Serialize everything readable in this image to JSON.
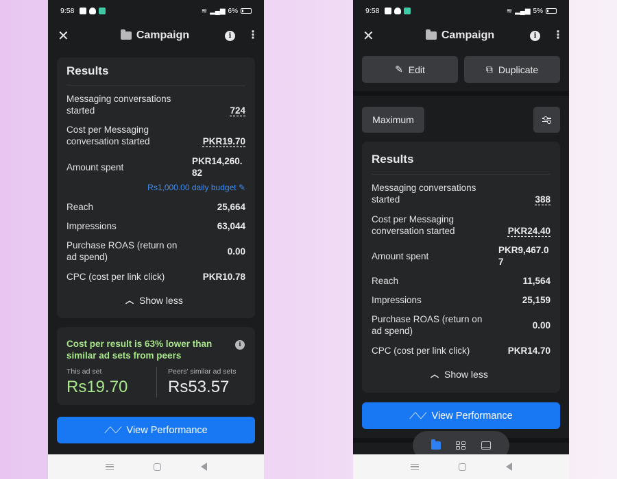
{
  "left_screen": {
    "status_bar": {
      "time": "9:58",
      "battery": "6%"
    },
    "header": {
      "title": "Campaign"
    },
    "results": {
      "title": "Results",
      "metrics": [
        {
          "label": "Messaging conversations started",
          "value": "724"
        },
        {
          "label": "Cost per Messaging conversation started",
          "value": "PKR19.70"
        },
        {
          "label": "Amount spent",
          "value": "PKR14,260.82"
        },
        {
          "label": "Reach",
          "value": "25,664"
        },
        {
          "label": "Impressions",
          "value": "63,044"
        },
        {
          "label": "Purchase ROAS (return on ad spend)",
          "value": "0.00"
        },
        {
          "label": "CPC (cost per link click)",
          "value": "PKR10.78"
        }
      ],
      "daily_budget": "Rs1,000.00 daily budget",
      "show_less": "Show less"
    },
    "peer_comparison": {
      "headline": "Cost per result is 63% lower than similar ad sets from peers",
      "this_label": "This ad set",
      "this_value": "Rs19.70",
      "peers_label": "Peers' similar ad sets",
      "peers_value": "Rs53.57"
    },
    "view_performance": "View Performance"
  },
  "right_screen": {
    "status_bar": {
      "time": "9:58",
      "battery": "5%"
    },
    "header": {
      "title": "Campaign"
    },
    "edit_label": "Edit",
    "duplicate_label": "Duplicate",
    "filter_label": "Maximum",
    "results": {
      "title": "Results",
      "metrics": [
        {
          "label": "Messaging conversations started",
          "value": "388"
        },
        {
          "label": "Cost per Messaging conversation started",
          "value": "PKR24.40"
        },
        {
          "label": "Amount spent",
          "value": "PKR9,467.07"
        },
        {
          "label": "Reach",
          "value": "11,564"
        },
        {
          "label": "Impressions",
          "value": "25,159"
        },
        {
          "label": "Purchase ROAS (return on ad spend)",
          "value": "0.00"
        },
        {
          "label": "CPC (cost per link click)",
          "value": "PKR14.70"
        }
      ],
      "show_less": "Show less"
    },
    "view_performance": "View Performance"
  },
  "icons": {
    "close": "close-icon",
    "folder": "folder-icon",
    "info": "info-icon",
    "more": "more-vertical-icon",
    "edit": "pencil-icon",
    "duplicate": "duplicate-icon",
    "filter": "sliders-icon",
    "trend": "trend-line-icon",
    "chevron": "chevron-up-icon"
  },
  "colors": {
    "background_dark": "#1b1c1e",
    "card": "#252628",
    "accent_blue": "#1877f2",
    "link_blue": "#3f8df2",
    "positive_green": "#a8e68a"
  }
}
